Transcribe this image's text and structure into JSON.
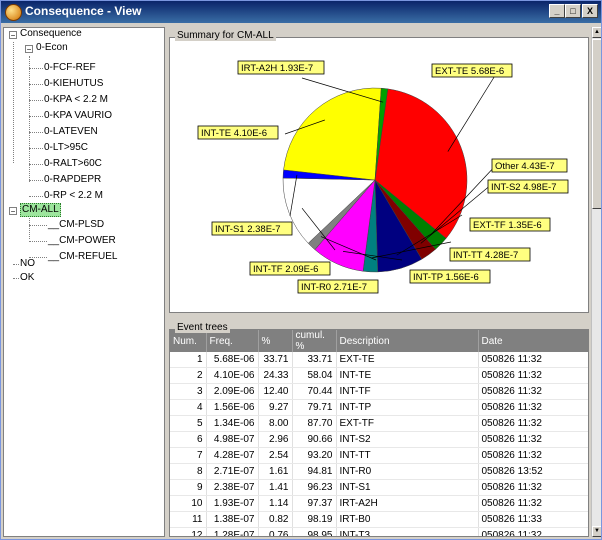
{
  "window": {
    "title": "Consequence - View",
    "buttons": [
      "_",
      "□",
      "X"
    ]
  },
  "tree": {
    "root": "Consequence",
    "econ": "0-Econ",
    "econ_children": [
      "0-FCF-REF",
      "0-KIEHUTUS",
      "0-KPA < 2.2 M",
      "0-KPA VAURIO",
      "0-LATEVEN",
      "0-LT>95C",
      "0-RALT>60C",
      "0-RAPDEPR",
      "0-RP < 2.2 M"
    ],
    "cm_all": "CM-ALL",
    "cm_children": [
      "__CM-PLSD",
      "__CM-POWER",
      "__CM-REFUEL"
    ],
    "others": [
      "NO",
      "OK"
    ]
  },
  "summary": {
    "title": "Summary for CM-ALL"
  },
  "chart_data": {
    "type": "pie",
    "title": "Summary for CM-ALL",
    "slices": [
      {
        "label": "EXT-TE 5.68E-6",
        "value": 5.68e-06,
        "color": "#ff0000"
      },
      {
        "label": "Other 4.43E-7",
        "value": 4.43e-07,
        "color": "#008000"
      },
      {
        "label": "INT-S2 4.98E-7",
        "value": 4.98e-07,
        "color": "#800000"
      },
      {
        "label": "EXT-TF 1.35E-6",
        "value": 1.35e-06,
        "color": "#000080"
      },
      {
        "label": "INT-TT 4.28E-7",
        "value": 4.28e-07,
        "color": "#008080"
      },
      {
        "label": "INT-TP 1.56E-6",
        "value": 1.56e-06,
        "color": "#ff00ff"
      },
      {
        "label": "INT-R0 2.71E-7",
        "value": 2.71e-07,
        "color": "#808080"
      },
      {
        "label": "INT-TF 2.09E-6",
        "value": 2.09e-06,
        "color": "#ffffff"
      },
      {
        "label": "INT-S1 2.38E-7",
        "value": 2.38e-07,
        "color": "#0000ff"
      },
      {
        "label": "INT-TE 4.10E-6",
        "value": 4.1e-06,
        "color": "#ffff00"
      },
      {
        "label": "IRT-A2H 1.93E-7",
        "value": 1.93e-07,
        "color": "#00a000"
      }
    ]
  },
  "events": {
    "title": "Event trees",
    "columns": [
      "Num.",
      "Freq.",
      "%",
      "cumul. %",
      "Description",
      "Date"
    ],
    "rows": [
      [
        "1",
        "5.68E-06",
        "33.71",
        "33.71",
        "EXT-TE",
        "050826 11:32"
      ],
      [
        "2",
        "4.10E-06",
        "24.33",
        "58.04",
        "INT-TE",
        "050826 11:32"
      ],
      [
        "3",
        "2.09E-06",
        "12.40",
        "70.44",
        "INT-TF",
        "050826 11:32"
      ],
      [
        "4",
        "1.56E-06",
        "9.27",
        "79.71",
        "INT-TP",
        "050826 11:32"
      ],
      [
        "5",
        "1.34E-06",
        "8.00",
        "87.70",
        "EXT-TF",
        "050826 11:32"
      ],
      [
        "6",
        "4.98E-07",
        "2.96",
        "90.66",
        "INT-S2",
        "050826 11:32"
      ],
      [
        "7",
        "4.28E-07",
        "2.54",
        "93.20",
        "INT-TT",
        "050826 11:32"
      ],
      [
        "8",
        "2.71E-07",
        "1.61",
        "94.81",
        "INT-R0",
        "050826 13:52"
      ],
      [
        "9",
        "2.38E-07",
        "1.41",
        "96.23",
        "INT-S1",
        "050826 11:32"
      ],
      [
        "10",
        "1.93E-07",
        "1.14",
        "97.37",
        "IRT-A2H",
        "050826 11:32"
      ],
      [
        "11",
        "1.38E-07",
        "0.82",
        "98.19",
        "IRT-B0",
        "050826 11:33"
      ],
      [
        "12",
        "1.28E-07",
        "0.76",
        "98.95",
        "INT-T3",
        "050826 11:32"
      ]
    ]
  }
}
